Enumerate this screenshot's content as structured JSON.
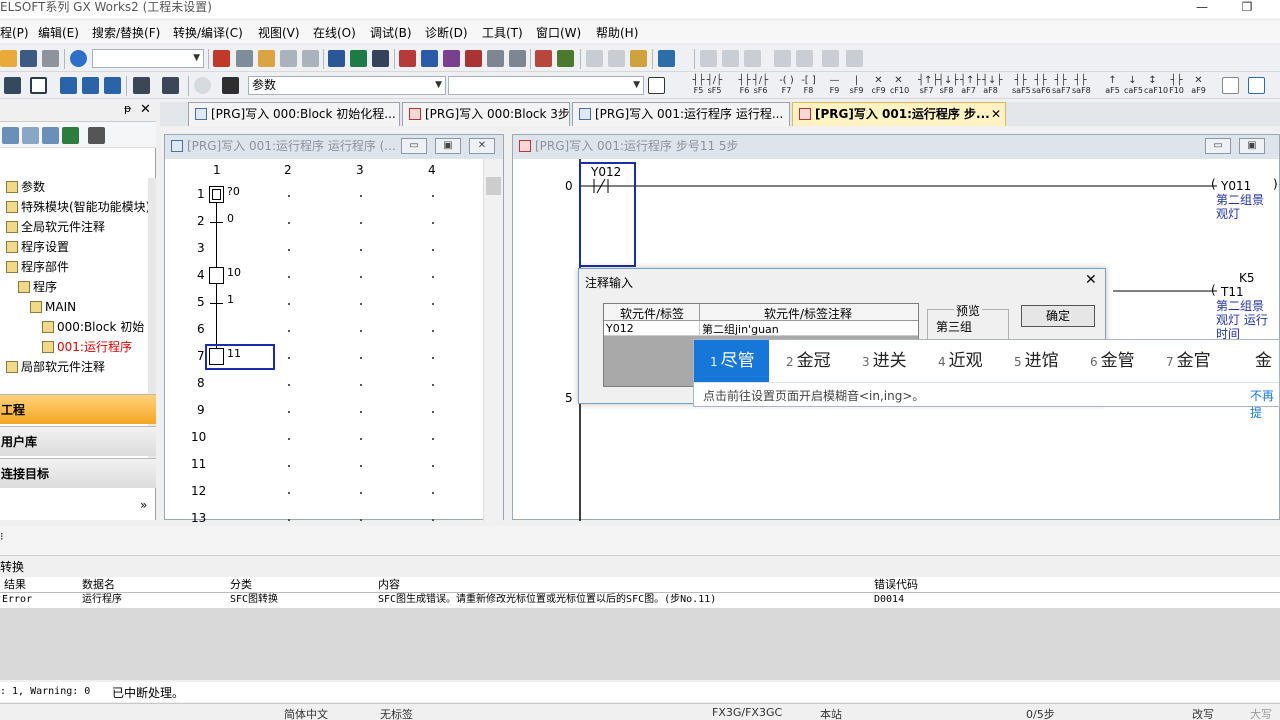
{
  "window": {
    "title": "ELSOFT系列 GX Works2 (工程未设置)",
    "minimize": "—",
    "restore": "❐"
  },
  "menu": {
    "items": [
      "程(P)",
      "编辑(E)",
      "搜索/替换(F)",
      "转换/编译(C)",
      "视图(V)",
      "在线(O)",
      "调试(B)",
      "诊断(D)",
      "工具(T)",
      "窗口(W)",
      "帮助(H)"
    ]
  },
  "toolbar": {
    "search_combo": "参数",
    "function_keys": [
      {
        "g": "┤├",
        "k": "F5"
      },
      {
        "g": "┤/├",
        "k": "sF5"
      },
      {
        "g": "┤├",
        "k": "F6"
      },
      {
        "g": "┤/├",
        "k": "sF6"
      },
      {
        "g": "-( )",
        "k": "F7"
      },
      {
        "g": "-[ ]",
        "k": "F8"
      },
      {
        "g": "—",
        "k": "F9"
      },
      {
        "g": "|",
        "k": "sF9"
      },
      {
        "g": "✕",
        "k": "cF9"
      },
      {
        "g": "✕",
        "k": "cF10"
      },
      {
        "g": "┤↑├",
        "k": "sF7"
      },
      {
        "g": "┤↓├",
        "k": "sF8"
      },
      {
        "g": "┤↑├",
        "k": "aF7"
      },
      {
        "g": "┤↓├",
        "k": "aF8"
      },
      {
        "g": "┤├",
        "k": "saF5"
      },
      {
        "g": "┤├",
        "k": "saF6"
      },
      {
        "g": "┤├",
        "k": "saF7"
      },
      {
        "g": "┤├",
        "k": "saF8"
      },
      {
        "g": "↑",
        "k": "aF5"
      },
      {
        "g": "↓",
        "k": "caF5"
      },
      {
        "g": "↕",
        "k": "caF10"
      },
      {
        "g": "┤├",
        "k": "F10"
      },
      {
        "g": "✕",
        "k": "aF9"
      }
    ]
  },
  "nav": {
    "header_pin": "ᵽ",
    "header_close": "✕",
    "tree": [
      {
        "label": "参数",
        "indent": 0
      },
      {
        "label": "特殊模块(智能功能模块)",
        "indent": 0
      },
      {
        "label": "全局软元件注释",
        "indent": 0
      },
      {
        "label": "程序设置",
        "indent": 0
      },
      {
        "label": "程序部件",
        "indent": 0
      },
      {
        "label": "程序",
        "indent": 1
      },
      {
        "label": "MAIN",
        "indent": 2
      },
      {
        "label": "000:Block 初始",
        "indent": 3
      },
      {
        "label": "001:运行程序",
        "indent": 3,
        "active": true
      },
      {
        "label": "局部软元件注释",
        "indent": 0
      }
    ],
    "buttons": [
      {
        "label": "工程",
        "active": true
      },
      {
        "label": "用户库",
        "active": false
      },
      {
        "label": "连接目标",
        "active": false
      }
    ],
    "more": "»"
  },
  "tabs": [
    {
      "label": "[PRG]写入 000:Block 初始化程...",
      "active": false
    },
    {
      "label": "[PRG]写入 000:Block 3步",
      "active": false
    },
    {
      "label": "[PRG]写入 001:运行程序 运行程...",
      "active": false
    },
    {
      "label": "[PRG]写入 001:运行程序 步...",
      "active": true
    }
  ],
  "tab_close": "✕",
  "sfc_window": {
    "caption": "[PRG]写入 001:运行程序 运行程序 (...",
    "columns": [
      "1",
      "2",
      "3",
      "4"
    ],
    "rows": [
      "1",
      "2",
      "3",
      "4",
      "5",
      "6",
      "7",
      "8",
      "9",
      "10",
      "11",
      "12",
      "13"
    ],
    "labels": [
      {
        "row": 1,
        "text": "?0"
      },
      {
        "row": 2,
        "text": "0"
      },
      {
        "row": 4,
        "text": "10"
      },
      {
        "row": 5,
        "text": "1"
      },
      {
        "row": 7,
        "text": "11"
      }
    ]
  },
  "ladder_window": {
    "caption": "[PRG]写入 001:运行程序 步号11 5步",
    "step0": "0",
    "step5": "5",
    "contact": "Y012",
    "coil1": "Y011",
    "coil1_comment": "第二组景\n观灯",
    "timer": "K5",
    "coil2": "T11",
    "coil2_comment": "第二组景\n观灯 运行\n时间"
  },
  "dialog": {
    "title": "注释输入",
    "col1": "软元件/标签",
    "col2": "软元件/标签注释",
    "row_device": "Y012",
    "row_comment": "第二组jin'guan",
    "preview_label": "预览",
    "preview_value": "第三组",
    "ok": "确定",
    "close": "✕"
  },
  "ime": {
    "candidates": [
      {
        "n": "1",
        "t": "尽管",
        "sel": true
      },
      {
        "n": "2",
        "t": "金冠"
      },
      {
        "n": "3",
        "t": "进关"
      },
      {
        "n": "4",
        "t": "近观"
      },
      {
        "n": "5",
        "t": "进馆"
      },
      {
        "n": "6",
        "t": "金管"
      },
      {
        "n": "7",
        "t": "金官"
      },
      {
        "n": "",
        "t": "金"
      }
    ],
    "hint": "点击前往设置页面开启模糊音<in,ing>。",
    "hint_right": "不再提"
  },
  "output": {
    "panel_title": "转换",
    "headers": [
      "结果",
      "数据名",
      "分类",
      "内容",
      "错误代码"
    ],
    "rows": [
      [
        "Error",
        "运行程序",
        "SFC图转换",
        "SFC图生成错误。请重新修改光标位置或光标位置以后的SFC图。(步No.11)",
        "D0014"
      ]
    ],
    "summary": ": 1, Warning: 0",
    "summary_msg": "已中断处理。"
  },
  "status": {
    "lang": "简体中文",
    "label": "无标签",
    "plc": "FX3G/FX3GC",
    "station": "本站",
    "steps": "0/5步",
    "mode": "改写",
    "caps": "大写"
  }
}
